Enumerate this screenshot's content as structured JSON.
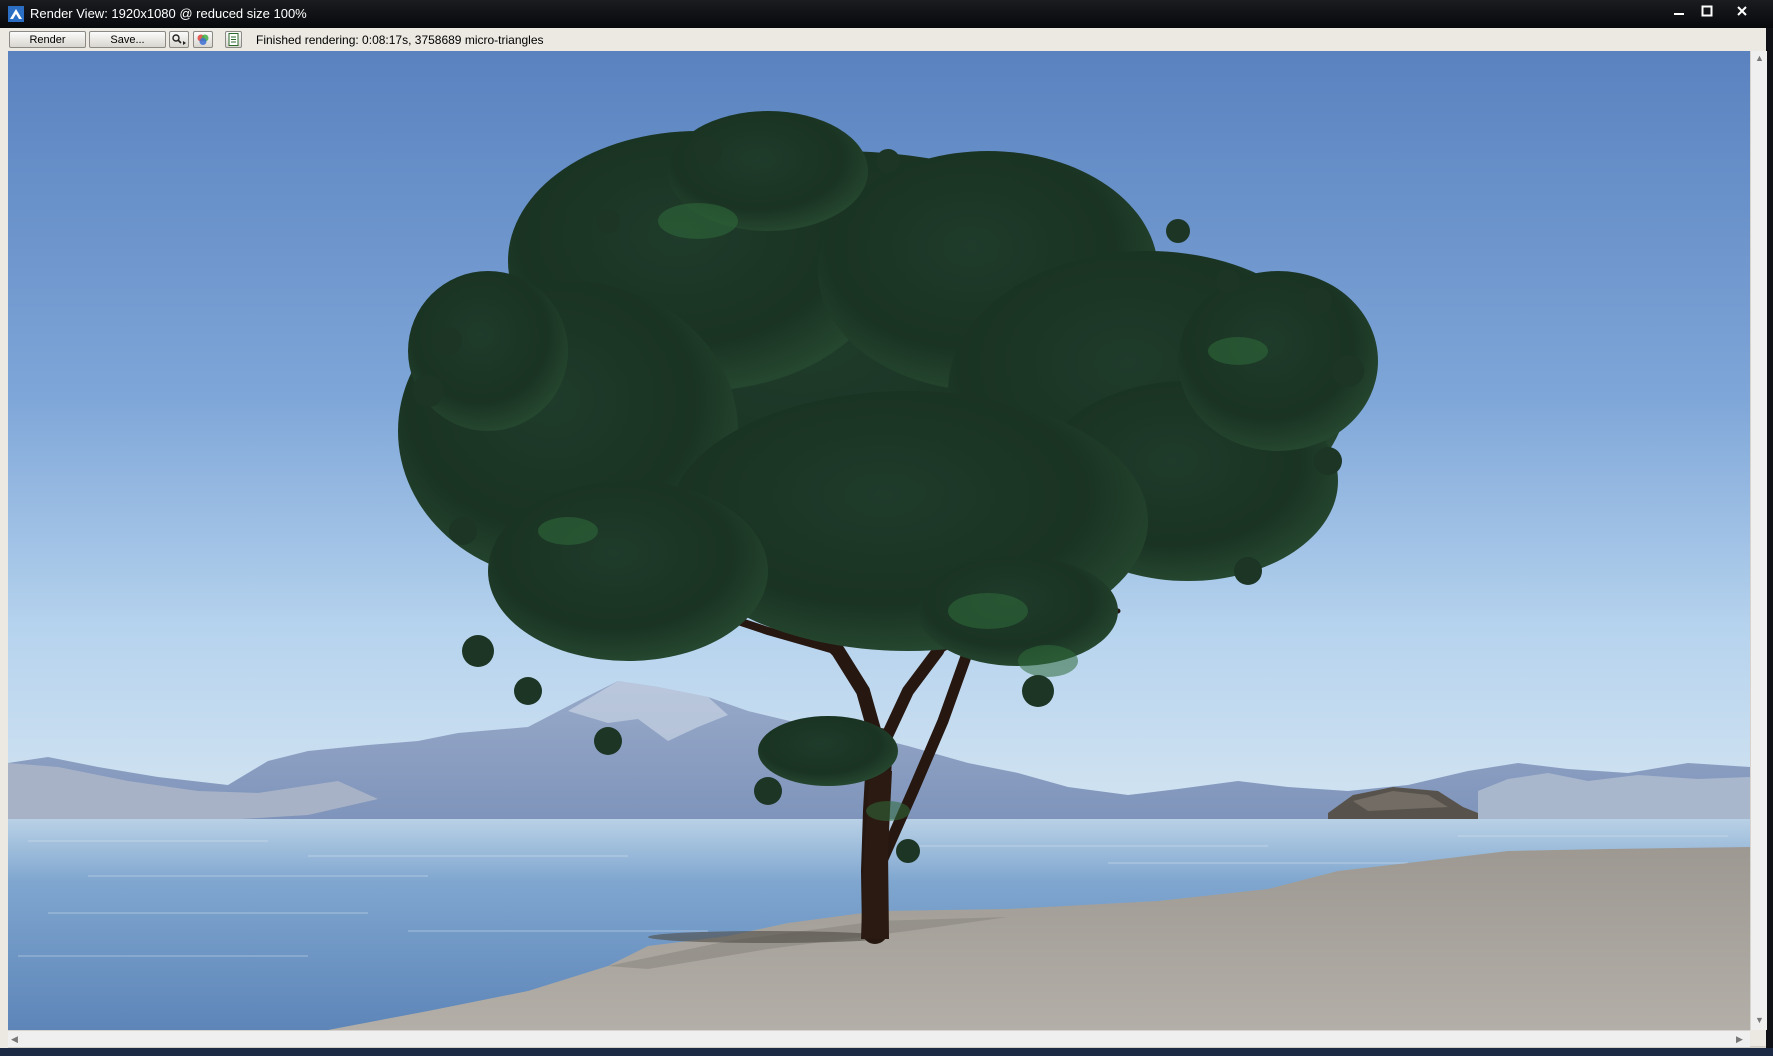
{
  "window": {
    "title": "Render View: 1920x1080 @ reduced size 100%",
    "controls": [
      "minimize",
      "maximize",
      "close"
    ]
  },
  "toolbar": {
    "render_label": "Render",
    "save_label": "Save...",
    "zoom_icon": "magnifier-icon",
    "color_icon": "color-wheel-icon",
    "log_icon": "document-icon",
    "status_text": "Finished rendering:  0:08:17s, 3758689 micro-triangles"
  },
  "colors": {
    "sky_top": "#5a82bf",
    "sky_bottom": "#c5dcef",
    "water": "#6f98c6",
    "sand": "#a39f98",
    "foliage": "#1c3424",
    "trunk": "#2a1a12"
  }
}
